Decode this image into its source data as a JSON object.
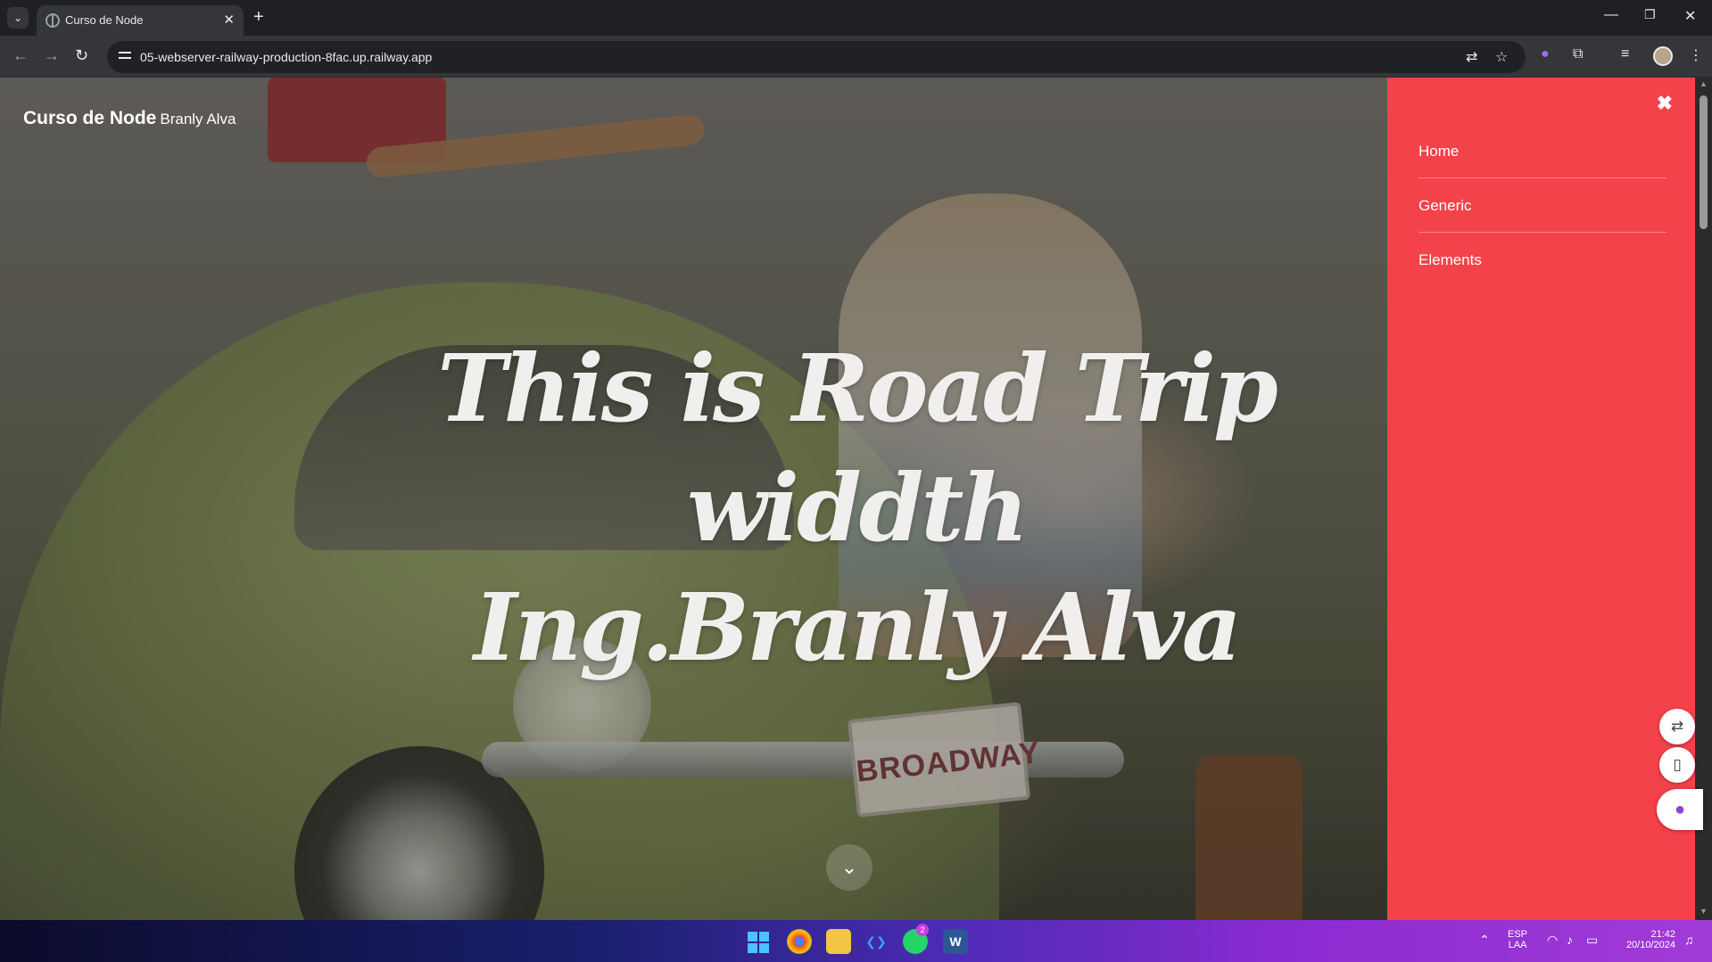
{
  "browser": {
    "tab_title": "Curso de Node",
    "url": "05-webserver-railway-production-8fac.up.railway.app"
  },
  "page": {
    "brand_main": "Curso de Node",
    "brand_sub": "Branly Alva",
    "hero_title": "This is Road Trip widdth Ing.Branly Alva",
    "license_plate": "BROADWAY",
    "menu": {
      "items": [
        {
          "label": "Home"
        },
        {
          "label": "Generic"
        },
        {
          "label": "Elements"
        }
      ]
    },
    "colors": {
      "menu_background": "#f4424a"
    }
  },
  "taskbar": {
    "language": "ESP",
    "layout": "LAA",
    "time": "21:42",
    "date": "20/10/2024",
    "whatsapp_badge": "2"
  }
}
